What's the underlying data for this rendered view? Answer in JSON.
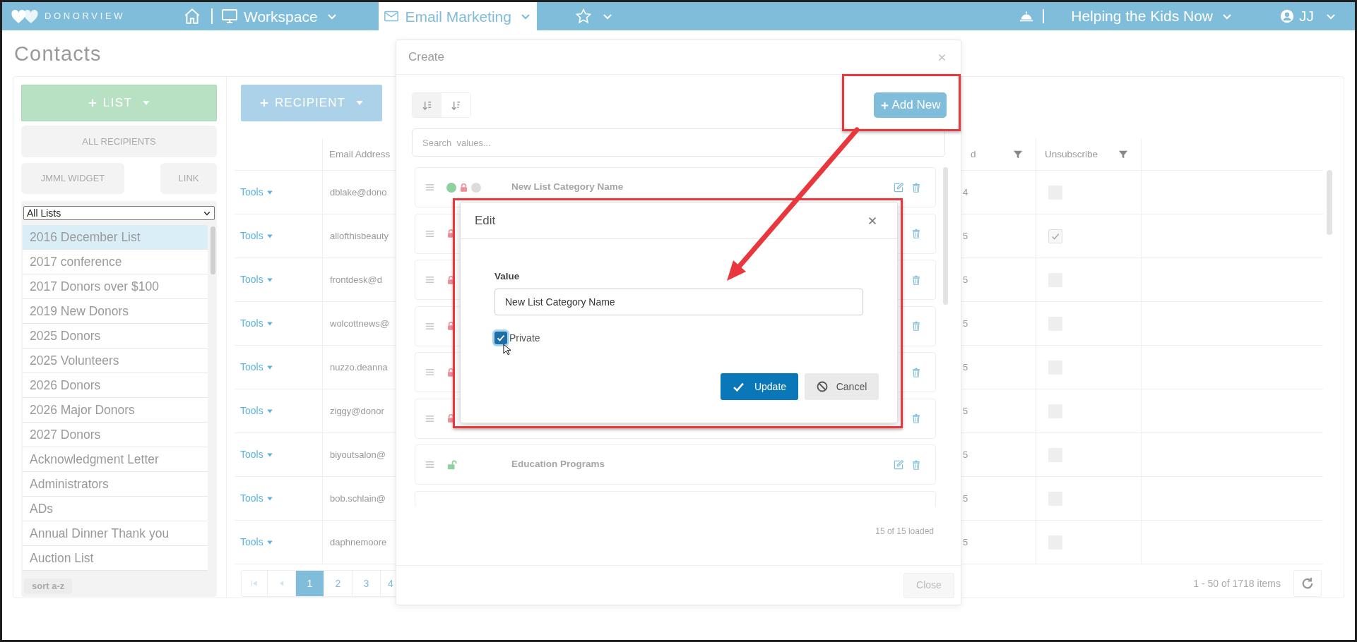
{
  "top_bar": {
    "logo_text": "DONORVIEW",
    "nav_items": [
      {
        "kind": "home",
        "selected": false
      },
      {
        "kind": "workspace",
        "label": "Workspace",
        "selected": false
      },
      {
        "kind": "email",
        "label": "Email Marketing",
        "selected": true
      },
      {
        "kind": "favorites",
        "selected": false
      }
    ],
    "organization": "Helping the Kids Now",
    "user": "JJ"
  },
  "page_title": "Contacts",
  "sidebar": {
    "add_list_button": "LIST",
    "all_recipients_button": "ALL RECIPIENTS",
    "widget_buttons": [
      "JMML WIDGET",
      "LINK"
    ],
    "list_filter": "All Lists",
    "lists": [
      {
        "name": "2016 December List",
        "selected": true
      },
      {
        "name": "2017 conference",
        "selected": false
      },
      {
        "name": "2017 Donors over $100",
        "selected": false
      },
      {
        "name": "2019 New Donors",
        "selected": false
      },
      {
        "name": "2025 Donors",
        "selected": false
      },
      {
        "name": "2025 Volunteers",
        "selected": false
      },
      {
        "name": "2026 Donors",
        "selected": false
      },
      {
        "name": "2026 Major Donors",
        "selected": false
      },
      {
        "name": "2027 Donors",
        "selected": false
      },
      {
        "name": "Acknowledgment Letter",
        "selected": false
      },
      {
        "name": "Administrators",
        "selected": false
      },
      {
        "name": "ADs",
        "selected": false
      },
      {
        "name": "Annual Dinner Thank you",
        "selected": false
      },
      {
        "name": "Auction List",
        "selected": false
      }
    ],
    "sort_button": "sort a-z"
  },
  "recipients": {
    "add_button": "RECIPIENT",
    "columns": [
      {
        "label": "Email Address",
        "filter": false
      },
      {
        "label": "d",
        "filter": true
      },
      {
        "label": "Unsubscribe",
        "filter": true
      }
    ],
    "rows": [
      {
        "tools": "Tools",
        "email": "dblake@dono",
        "column_3": "4",
        "unsubscribe": false
      },
      {
        "tools": "Tools",
        "email": "allofthisbeauty",
        "column_3": "5",
        "unsubscribe": true
      },
      {
        "tools": "Tools",
        "email": "frontdesk@d",
        "column_3": "5",
        "unsubscribe": false
      },
      {
        "tools": "Tools",
        "email": "wolcottnews@",
        "column_3": "5",
        "unsubscribe": false
      },
      {
        "tools": "Tools",
        "email": "nuzzo.deanna",
        "column_3": "5",
        "unsubscribe": false
      },
      {
        "tools": "Tools",
        "email": "ziggy@donor",
        "column_3": "5",
        "unsubscribe": false
      },
      {
        "tools": "Tools",
        "email": "biyoutsalon@",
        "column_3": "5",
        "unsubscribe": false
      },
      {
        "tools": "Tools",
        "email": "bob.schlain@",
        "column_3": "5",
        "unsubscribe": false
      },
      {
        "tools": "Tools",
        "email": "daphnemoore",
        "column_3": "5",
        "unsubscribe": false
      }
    ],
    "pager": {
      "pages": [
        {
          "label": "1",
          "selected": true
        },
        {
          "label": "2",
          "selected": false
        },
        {
          "label": "3",
          "selected": false
        },
        {
          "label": "4",
          "selected": false
        }
      ],
      "summary": "1 - 50 of 1718 items"
    }
  },
  "create_dialog": {
    "title": "Create",
    "sort_buttons": [
      {
        "kind": "ascending",
        "selected": true
      },
      {
        "kind": "descending",
        "selected": false
      }
    ],
    "add_new_button": "Add New",
    "search_placeholder": "Search  values...",
    "items": [
      {
        "kind": "full",
        "name": "New List Category Name",
        "markers": [
          {
            "kind": "dot",
            "color": "#8fd19e"
          },
          {
            "kind": "lock",
            "locked": true
          },
          {
            "kind": "dot",
            "color": "#dcdcdc"
          }
        ]
      },
      {
        "kind": "full",
        "markers": [
          {
            "kind": "lock",
            "locked": true
          }
        ]
      },
      {
        "kind": "full",
        "markers": [
          {
            "kind": "lock",
            "locked": true
          }
        ]
      },
      {
        "kind": "full",
        "markers": [
          {
            "kind": "lock",
            "locked": true
          }
        ]
      },
      {
        "kind": "full",
        "markers": [
          {
            "kind": "lock",
            "locked": true
          }
        ]
      },
      {
        "kind": "full",
        "markers": [
          {
            "kind": "lock",
            "locked": true
          }
        ]
      },
      {
        "kind": "full",
        "name": "Education Programs",
        "markers": [
          {
            "kind": "lock",
            "locked": false
          }
        ]
      },
      {
        "kind": "clipped"
      }
    ],
    "loaded_text": "15 of 15 loaded",
    "close_button": "Close"
  },
  "edit_dialog": {
    "title": "Edit",
    "value_label": "Value",
    "value": "New List Category Name",
    "private_label": "Private",
    "private_checked": true,
    "update_button": "Update",
    "cancel_button": "Cancel"
  }
}
